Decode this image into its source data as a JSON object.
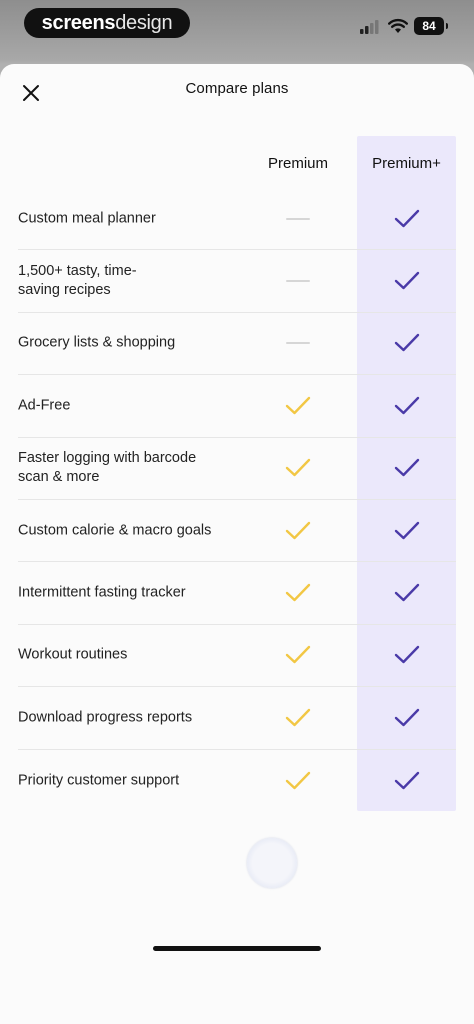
{
  "status_bar": {
    "brand_bold": "screens",
    "brand_light": "design",
    "battery": "84",
    "signal_icon": "cellular-signal-icon",
    "wifi_icon": "wifi-icon"
  },
  "header": {
    "title": "Compare plans",
    "close_icon": "close-icon"
  },
  "columns": {
    "premium": "Premium",
    "premium_plus": "Premium+"
  },
  "colors": {
    "premium_check": "#f2c744",
    "premium_plus_check": "#4a3aa8",
    "dash": "#d6d6d6",
    "plus_column_bg": "#ebe8fb"
  },
  "features": [
    {
      "label": "Custom meal planner",
      "premium": false,
      "premium_plus": true
    },
    {
      "label": "1,500+ tasty, time-\nsaving recipes",
      "premium": false,
      "premium_plus": true
    },
    {
      "label": "Grocery lists & shopping",
      "premium": false,
      "premium_plus": true
    },
    {
      "label": "Ad-Free",
      "premium": true,
      "premium_plus": true
    },
    {
      "label": "Faster logging with barcode\nscan & more",
      "premium": true,
      "premium_plus": true
    },
    {
      "label": "Custom calorie & macro goals",
      "premium": true,
      "premium_plus": true
    },
    {
      "label": "Intermittent fasting tracker",
      "premium": true,
      "premium_plus": true
    },
    {
      "label": "Workout routines",
      "premium": true,
      "premium_plus": true
    },
    {
      "label": "Download progress reports",
      "premium": true,
      "premium_plus": true
    },
    {
      "label": "Priority customer support",
      "premium": true,
      "premium_plus": true
    }
  ]
}
